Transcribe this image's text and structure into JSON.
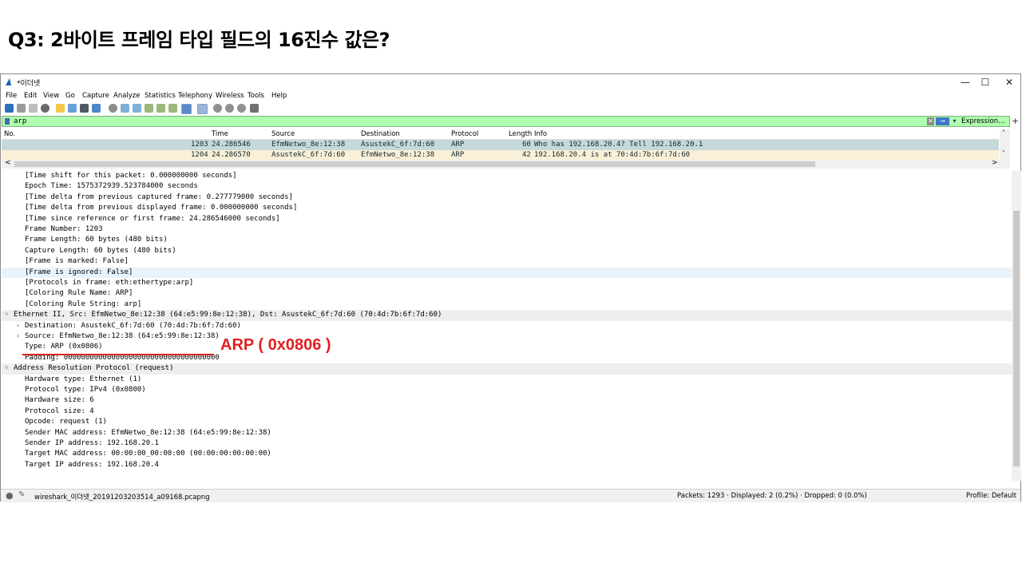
{
  "slide": {
    "title": "Q3: 2바이트 프레임 타입 필드의 16진수 값은?"
  },
  "window": {
    "title": "*이더넷",
    "controls": {
      "minimize": "—",
      "maximize": "☐",
      "close": "✕"
    }
  },
  "menu": [
    "File",
    "Edit",
    "View",
    "Go",
    "Capture",
    "Analyze",
    "Statistics",
    "Telephony",
    "Wireless",
    "Tools",
    "Help"
  ],
  "filter": {
    "value": "arp",
    "expression_label": "Expression…",
    "plus": "+"
  },
  "packet_list": {
    "columns": [
      "No.",
      "Time",
      "Source",
      "Destination",
      "Protocol",
      "Length",
      "Info"
    ],
    "rows": [
      {
        "no": "1203",
        "time": "24.286546",
        "source": "EfmNetwo_8e:12:38",
        "destination": "AsustekC_6f:7d:60",
        "protocol": "ARP",
        "length": "60",
        "info": "Who has 192.168.20.4? Tell 192.168.20.1",
        "bg": "#c5d9da"
      },
      {
        "no": "1204",
        "time": "24.286570",
        "source": "AsustekC_6f:7d:60",
        "destination": "EfmNetwo_8e:12:38",
        "protocol": "ARP",
        "length": "42",
        "info": "192.168.20.4 is at 70:4d:7b:6f:7d:60",
        "bg": "#faf0d7"
      }
    ]
  },
  "details": [
    {
      "text": "[Time shift for this packet: 0.000000000 seconds]",
      "indent": 2,
      "arrow": "",
      "style": ""
    },
    {
      "text": "Epoch Time: 1575372939.523784000 seconds",
      "indent": 2,
      "arrow": "",
      "style": ""
    },
    {
      "text": "[Time delta from previous captured frame: 0.277779000 seconds]",
      "indent": 2,
      "arrow": "",
      "style": ""
    },
    {
      "text": "[Time delta from previous displayed frame: 0.000000000 seconds]",
      "indent": 2,
      "arrow": "",
      "style": ""
    },
    {
      "text": "[Time since reference or first frame: 24.286546000 seconds]",
      "indent": 2,
      "arrow": "",
      "style": ""
    },
    {
      "text": "Frame Number: 1203",
      "indent": 2,
      "arrow": "",
      "style": ""
    },
    {
      "text": "Frame Length: 60 bytes (480 bits)",
      "indent": 2,
      "arrow": "",
      "style": ""
    },
    {
      "text": "Capture Length: 60 bytes (480 bits)",
      "indent": 2,
      "arrow": "",
      "style": ""
    },
    {
      "text": "[Frame is marked: False]",
      "indent": 2,
      "arrow": "",
      "style": ""
    },
    {
      "text": "[Frame is ignored: False]",
      "indent": 2,
      "arrow": "",
      "style": "hl"
    },
    {
      "text": "[Protocols in frame: eth:ethertype:arp]",
      "indent": 2,
      "arrow": "",
      "style": ""
    },
    {
      "text": "[Coloring Rule Name: ARP]",
      "indent": 2,
      "arrow": "",
      "style": ""
    },
    {
      "text": "[Coloring Rule String: arp]",
      "indent": 2,
      "arrow": "",
      "style": ""
    },
    {
      "text": "Ethernet II, Src: EfmNetwo_8e:12:38 (64:e5:99:8e:12:38), Dst: AsustekC_6f:7d:60 (70:4d:7b:6f:7d:60)",
      "indent": 1,
      "arrow": "˅",
      "style": "sec"
    },
    {
      "text": "Destination: AsustekC_6f:7d:60 (70:4d:7b:6f:7d:60)",
      "indent": 2,
      "arrow": "›",
      "style": ""
    },
    {
      "text": "Source: EfmNetwo_8e:12:38 (64:e5:99:8e:12:38)",
      "indent": 2,
      "arrow": "›",
      "style": ""
    },
    {
      "text": "Type: ARP (0x0806)",
      "indent": 2,
      "arrow": "",
      "style": ""
    },
    {
      "text": "Padding: 000000000000000000000000000000000000",
      "indent": 2,
      "arrow": "",
      "style": ""
    },
    {
      "text": "Address Resolution Protocol (request)",
      "indent": 1,
      "arrow": "˅",
      "style": "sec"
    },
    {
      "text": "Hardware type: Ethernet (1)",
      "indent": 2,
      "arrow": "",
      "style": ""
    },
    {
      "text": "Protocol type: IPv4 (0x0800)",
      "indent": 2,
      "arrow": "",
      "style": ""
    },
    {
      "text": "Hardware size: 6",
      "indent": 2,
      "arrow": "",
      "style": ""
    },
    {
      "text": "Protocol size: 4",
      "indent": 2,
      "arrow": "",
      "style": ""
    },
    {
      "text": "Opcode: request (1)",
      "indent": 2,
      "arrow": "",
      "style": ""
    },
    {
      "text": "Sender MAC address: EfmNetwo_8e:12:38 (64:e5:99:8e:12:38)",
      "indent": 2,
      "arrow": "",
      "style": ""
    },
    {
      "text": "Sender IP address: 192.168.20.1",
      "indent": 2,
      "arrow": "",
      "style": ""
    },
    {
      "text": "Target MAC address: 00:00:00_00:00:00 (00:00:00:00:00:00)",
      "indent": 2,
      "arrow": "",
      "style": ""
    },
    {
      "text": "Target IP address: 192.168.20.4",
      "indent": 2,
      "arrow": "",
      "style": ""
    }
  ],
  "annotation": {
    "text": "ARP ( 0x0806 )",
    "color": "#e02020"
  },
  "status": {
    "file": "wireshark_이더넷_20191203203514_a09168.pcapng",
    "packets": "Packets: 1293 · Displayed: 2 (0.2%) · Dropped: 0 (0.0%)",
    "profile": "Profile: Default"
  },
  "scroll": {
    "left_arrow": "<",
    "right_arrow": ">",
    "up_arrow": "˄",
    "down_arrow": "˅"
  }
}
